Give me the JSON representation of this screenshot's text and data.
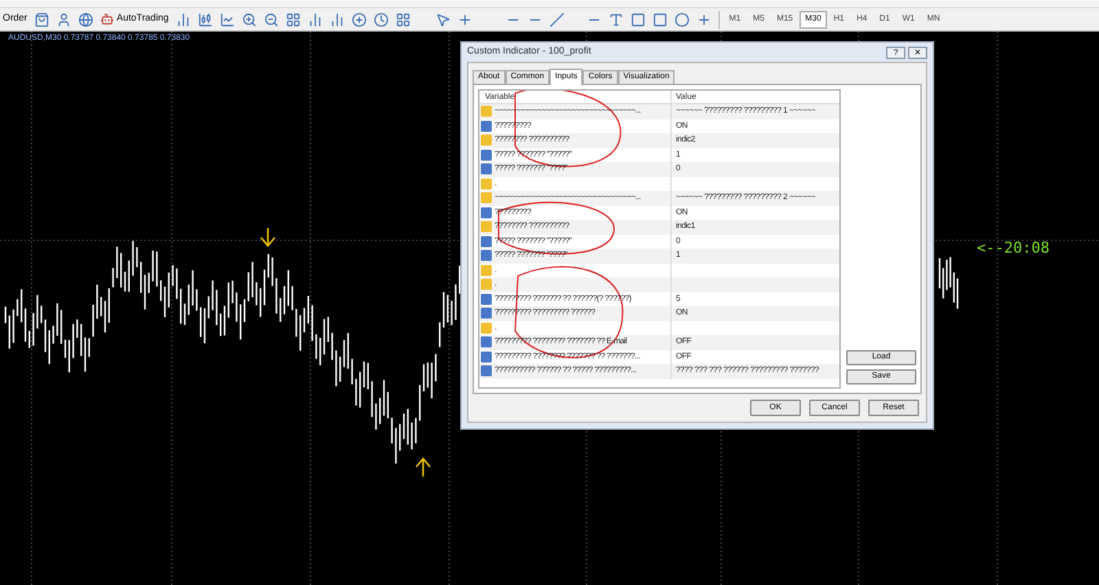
{
  "toolbar": {
    "order": "Order",
    "autotrading": "AutoTrading",
    "timeframes": [
      {
        "label": "M1",
        "selected": false
      },
      {
        "label": "M5",
        "selected": false
      },
      {
        "label": "M15",
        "selected": false
      },
      {
        "label": "M30",
        "selected": true
      },
      {
        "label": "H1",
        "selected": false
      },
      {
        "label": "H4",
        "selected": false
      },
      {
        "label": "D1",
        "selected": false
      },
      {
        "label": "W1",
        "selected": false
      },
      {
        "label": "MN",
        "selected": false
      }
    ]
  },
  "chart": {
    "symbol_line": "AUDUSD,M30  0.73787 0.73840 0.73785 0.73830",
    "timer_label": "<--20:08"
  },
  "dialog": {
    "title": "Custom Indicator - 100_profit",
    "help_button": "?",
    "close_button": "✕",
    "tabs": [
      {
        "label": "About",
        "selected": false
      },
      {
        "label": "Common",
        "selected": false
      },
      {
        "label": "Inputs",
        "selected": true
      },
      {
        "label": "Colors",
        "selected": false
      },
      {
        "label": "Visualization",
        "selected": false
      }
    ],
    "columns": [
      "Variable",
      "Value"
    ],
    "rows": [
      {
        "kind": "string",
        "variable": "~~~~~~~~~~~~~~~~~~~~~~~~~~~~~~~~~...",
        "value": "~~~~~~ ????????? ????????? 1 ~~~~~~"
      },
      {
        "kind": "number",
        "variable": "?????????",
        "value": "ON"
      },
      {
        "kind": "string",
        "variable": "???????? ??????????",
        "value": "indic2"
      },
      {
        "kind": "number",
        "variable": "????? ??????? \"?????\"",
        "value": "1"
      },
      {
        "kind": "number",
        "variable": "????? ??????? \"????\"",
        "value": "0"
      },
      {
        "kind": "string",
        "variable": ".",
        "value": ""
      },
      {
        "kind": "string",
        "variable": "~~~~~~~~~~~~~~~~~~~~~~~~~~~~~~~~~...",
        "value": "~~~~~~ ????????? ????????? 2 ~~~~~~"
      },
      {
        "kind": "number",
        "variable": "?????????",
        "value": "ON"
      },
      {
        "kind": "string",
        "variable": "???????? ??????????",
        "value": "indic1"
      },
      {
        "kind": "number",
        "variable": "????? ??????? \"?????\"",
        "value": "0"
      },
      {
        "kind": "number",
        "variable": "????? ??????? \"????\"",
        "value": "1"
      },
      {
        "kind": "string",
        "variable": ".",
        "value": ""
      },
      {
        "kind": "string",
        "variable": ".",
        "value": ""
      },
      {
        "kind": "number",
        "variable": "????????? ??????? ?? ??????(? ??????)",
        "value": "5"
      },
      {
        "kind": "number",
        "variable": "????????? ????????? ??????",
        "value": "ON"
      },
      {
        "kind": "string",
        "variable": ".",
        "value": ""
      },
      {
        "kind": "number",
        "variable": "????????? ???????? ??????? ?? E-mail",
        "value": "OFF"
      },
      {
        "kind": "number",
        "variable": "????????? ???????? ??????? ?? ???????...",
        "value": "OFF"
      },
      {
        "kind": "number",
        "variable": "?????????? ?????? ?? ????? ?????????...",
        "value": "???? ??? ??? ?????? ????????? ???????"
      }
    ],
    "side_buttons": [
      "Load",
      "Save"
    ],
    "buttons": [
      "OK",
      "Cancel",
      "Reset"
    ]
  }
}
